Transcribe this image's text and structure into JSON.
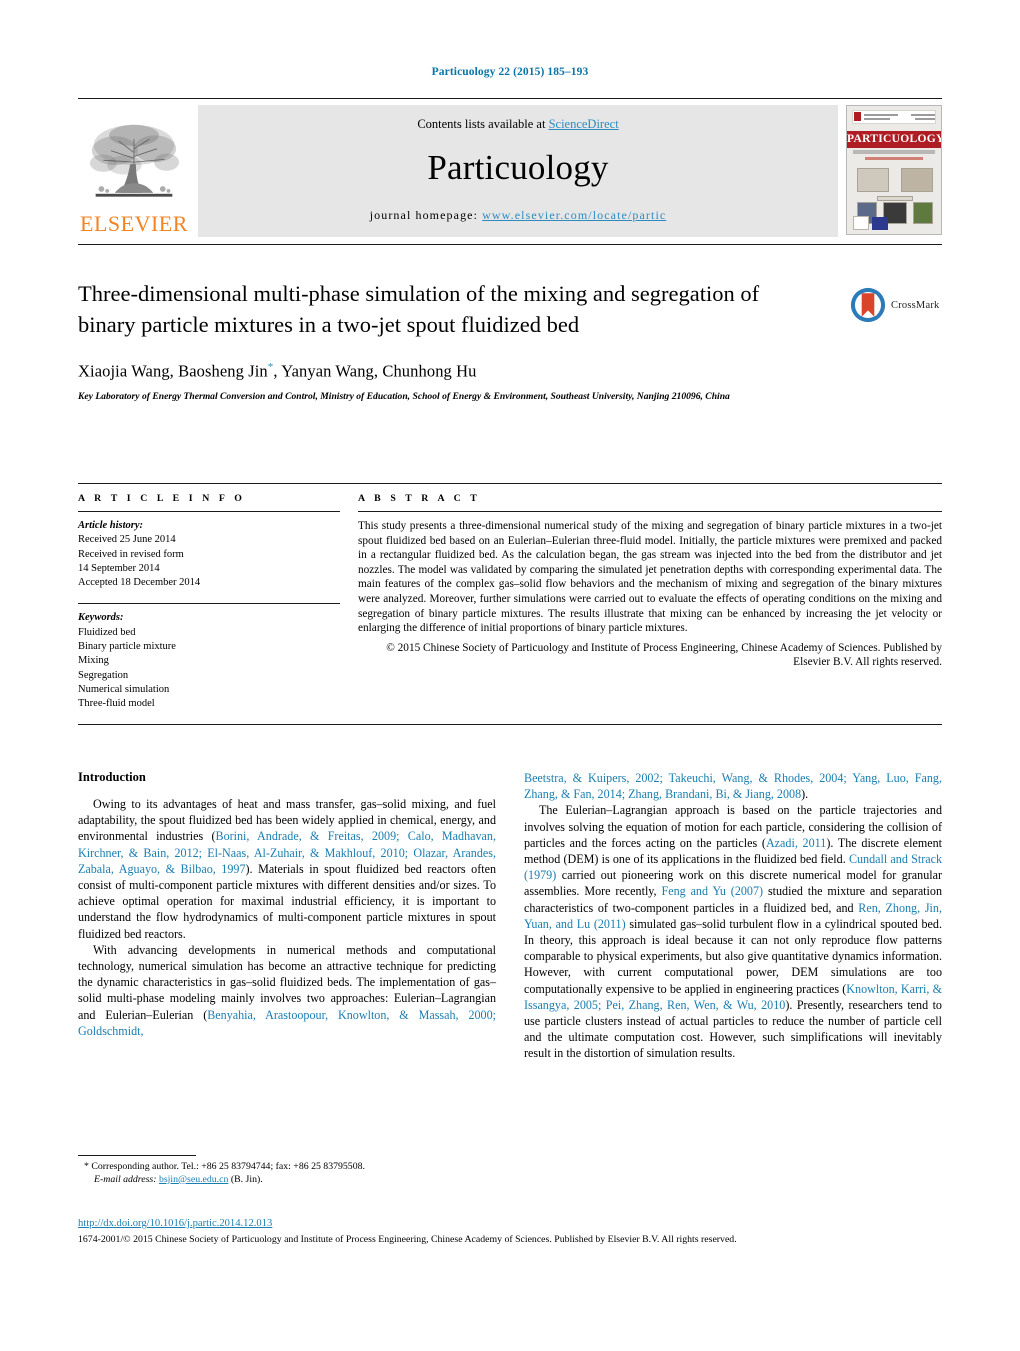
{
  "running_head": "Particuology 22 (2015) 185–193",
  "masthead": {
    "publisher_logo_label": "ELSEVIER",
    "contents_prefix": "Contents lists available at ",
    "contents_link": "ScienceDirect",
    "journal_title": "Particuology",
    "homepage_label": "journal homepage:",
    "homepage_url": "www.elsevier.com/locate/partic",
    "cover_title": "PARTICUOLOGY",
    "link_color": "#2e8bc0",
    "elsevier_orange": "#f58220"
  },
  "article": {
    "title": "Three-dimensional multi-phase simulation of the mixing and segregation of binary particle mixtures in a two-jet spout fluidized bed",
    "authors": "Xiaojia Wang, Baosheng Jin",
    "authors_tail": ", Yanyan Wang, Chunhong Hu",
    "corresponding_marker": "*",
    "affiliation": "Key Laboratory of Energy Thermal Conversion and Control, Ministry of Education, School of Energy & Environment, Southeast University, Nanjing 210096, China",
    "crossmark_label": "CrossMark"
  },
  "article_info": {
    "heading": "A R T I C L E   I N F O",
    "history_label": "Article history:",
    "history": [
      "Received 25 June 2014",
      "Received in revised form",
      "14 September 2014",
      "Accepted 18 December 2014"
    ],
    "keywords_label": "Keywords:",
    "keywords": [
      "Fluidized bed",
      "Binary particle mixture",
      "Mixing",
      "Segregation",
      "Numerical simulation",
      "Three-fluid model"
    ]
  },
  "abstract": {
    "heading": "A B S T R A C T",
    "text": "This study presents a three-dimensional numerical study of the mixing and segregation of binary particle mixtures in a two-jet spout fluidized bed based on an Eulerian–Eulerian three-fluid model. Initially, the particle mixtures were premixed and packed in a rectangular fluidized bed. As the calculation began, the gas stream was injected into the bed from the distributor and jet nozzles. The model was validated by comparing the simulated jet penetration depths with corresponding experimental data. The main features of the complex gas–solid flow behaviors and the mechanism of mixing and segregation of the binary mixtures were analyzed. Moreover, further simulations were carried out to evaluate the effects of operating conditions on the mixing and segregation of binary particle mixtures. The results illustrate that mixing can be enhanced by increasing the jet velocity or enlarging the difference of initial proportions of binary particle mixtures.",
    "copyright": "© 2015 Chinese Society of Particuology and Institute of Process Engineering, Chinese Academy of Sciences. Published by Elsevier B.V. All rights reserved."
  },
  "body": {
    "section_heading": "Introduction",
    "left": {
      "p1_a": "Owing to its advantages of heat and mass transfer, gas–solid mixing, and fuel adaptability, the spout fluidized bed has been widely applied in chemical, energy, and environmental industries (",
      "p1_refs": "Borini, Andrade, & Freitas, 2009; Calo, Madhavan, Kirchner, & Bain, 2012; El-Naas, Al-Zuhair, & Makhlouf, 2010; Olazar, Arandes, Zabala, Aguayo, & Bilbao, 1997",
      "p1_b": "). Materials in spout fluidized bed reactors often consist of multi-component particle mixtures with different densities and/or sizes. To achieve optimal operation for maximal industrial efficiency, it is important to understand the flow hydrodynamics of multi-component particle mixtures in spout fluidized bed reactors.",
      "p2_a": "With advancing developments in numerical methods and computational technology, numerical simulation has become an attractive technique for predicting the dynamic characteristics in gas–solid fluidized beds. The implementation of gas–solid multi-phase modeling mainly involves two approaches: Eulerian–Lagrangian and Eulerian–Eulerian (",
      "p2_refs_left": "Benyahia, Arastoopour, Knowlton, & Massah, 2000; Goldschmidt,"
    },
    "right": {
      "p2_refs_cont": "Beetstra, & Kuipers, 2002; Takeuchi, Wang, & Rhodes, 2004; Yang, Luo, Fang, Zhang, & Fan, 2014; Zhang, Brandani, Bi, & Jiang, 2008",
      "p2_tail": ").",
      "p3_a": "The Eulerian–Lagrangian approach is based on the particle trajectories and involves solving the equation of motion for each particle, considering the collision of particles and the forces acting on the particles (",
      "p3_ref1": "Azadi, 2011",
      "p3_b": "). The discrete element method (DEM) is one of its applications in the fluidized bed field. ",
      "p3_ref2": "Cundall and Strack (1979)",
      "p3_c": " carried out pioneering work on this discrete numerical model for granular assemblies. More recently, ",
      "p3_ref3": "Feng and Yu (2007)",
      "p3_d": " studied the mixture and separation characteristics of two-component particles in a fluidized bed, and ",
      "p3_ref4": "Ren, Zhong, Jin, Yuan, and Lu (2011)",
      "p3_e": " simulated gas–solid turbulent flow in a cylindrical spouted bed. In theory, this approach is ideal because it can not only reproduce flow patterns comparable to physical experiments, but also give quantitative dynamics information. However, with current computational power, DEM simulations are too computationally expensive to be applied in engineering practices (",
      "p3_ref5": "Knowlton, Karri, & Issangya, 2005; Pei, Zhang, Ren, Wen, & Wu, 2010",
      "p3_f": "). Presently, researchers tend to use particle clusters instead of actual particles to reduce the number of particle cell and the ultimate computation cost. However, such simplifications will inevitably result in the distortion of simulation results."
    }
  },
  "footnote": {
    "marker": "*",
    "corresponding": "Corresponding author. Tel.: +86 25 83794744; fax: +86 25 83795508.",
    "email_label": "E-mail address:",
    "email": "bsjin@seu.edu.cn",
    "email_owner": "(B. Jin)."
  },
  "footer": {
    "doi": "http://dx.doi.org/10.1016/j.partic.2014.12.013",
    "copyright": "1674-2001/© 2015 Chinese Society of Particuology and Institute of Process Engineering, Chinese Academy of Sciences. Published by Elsevier B.V. All rights reserved."
  }
}
